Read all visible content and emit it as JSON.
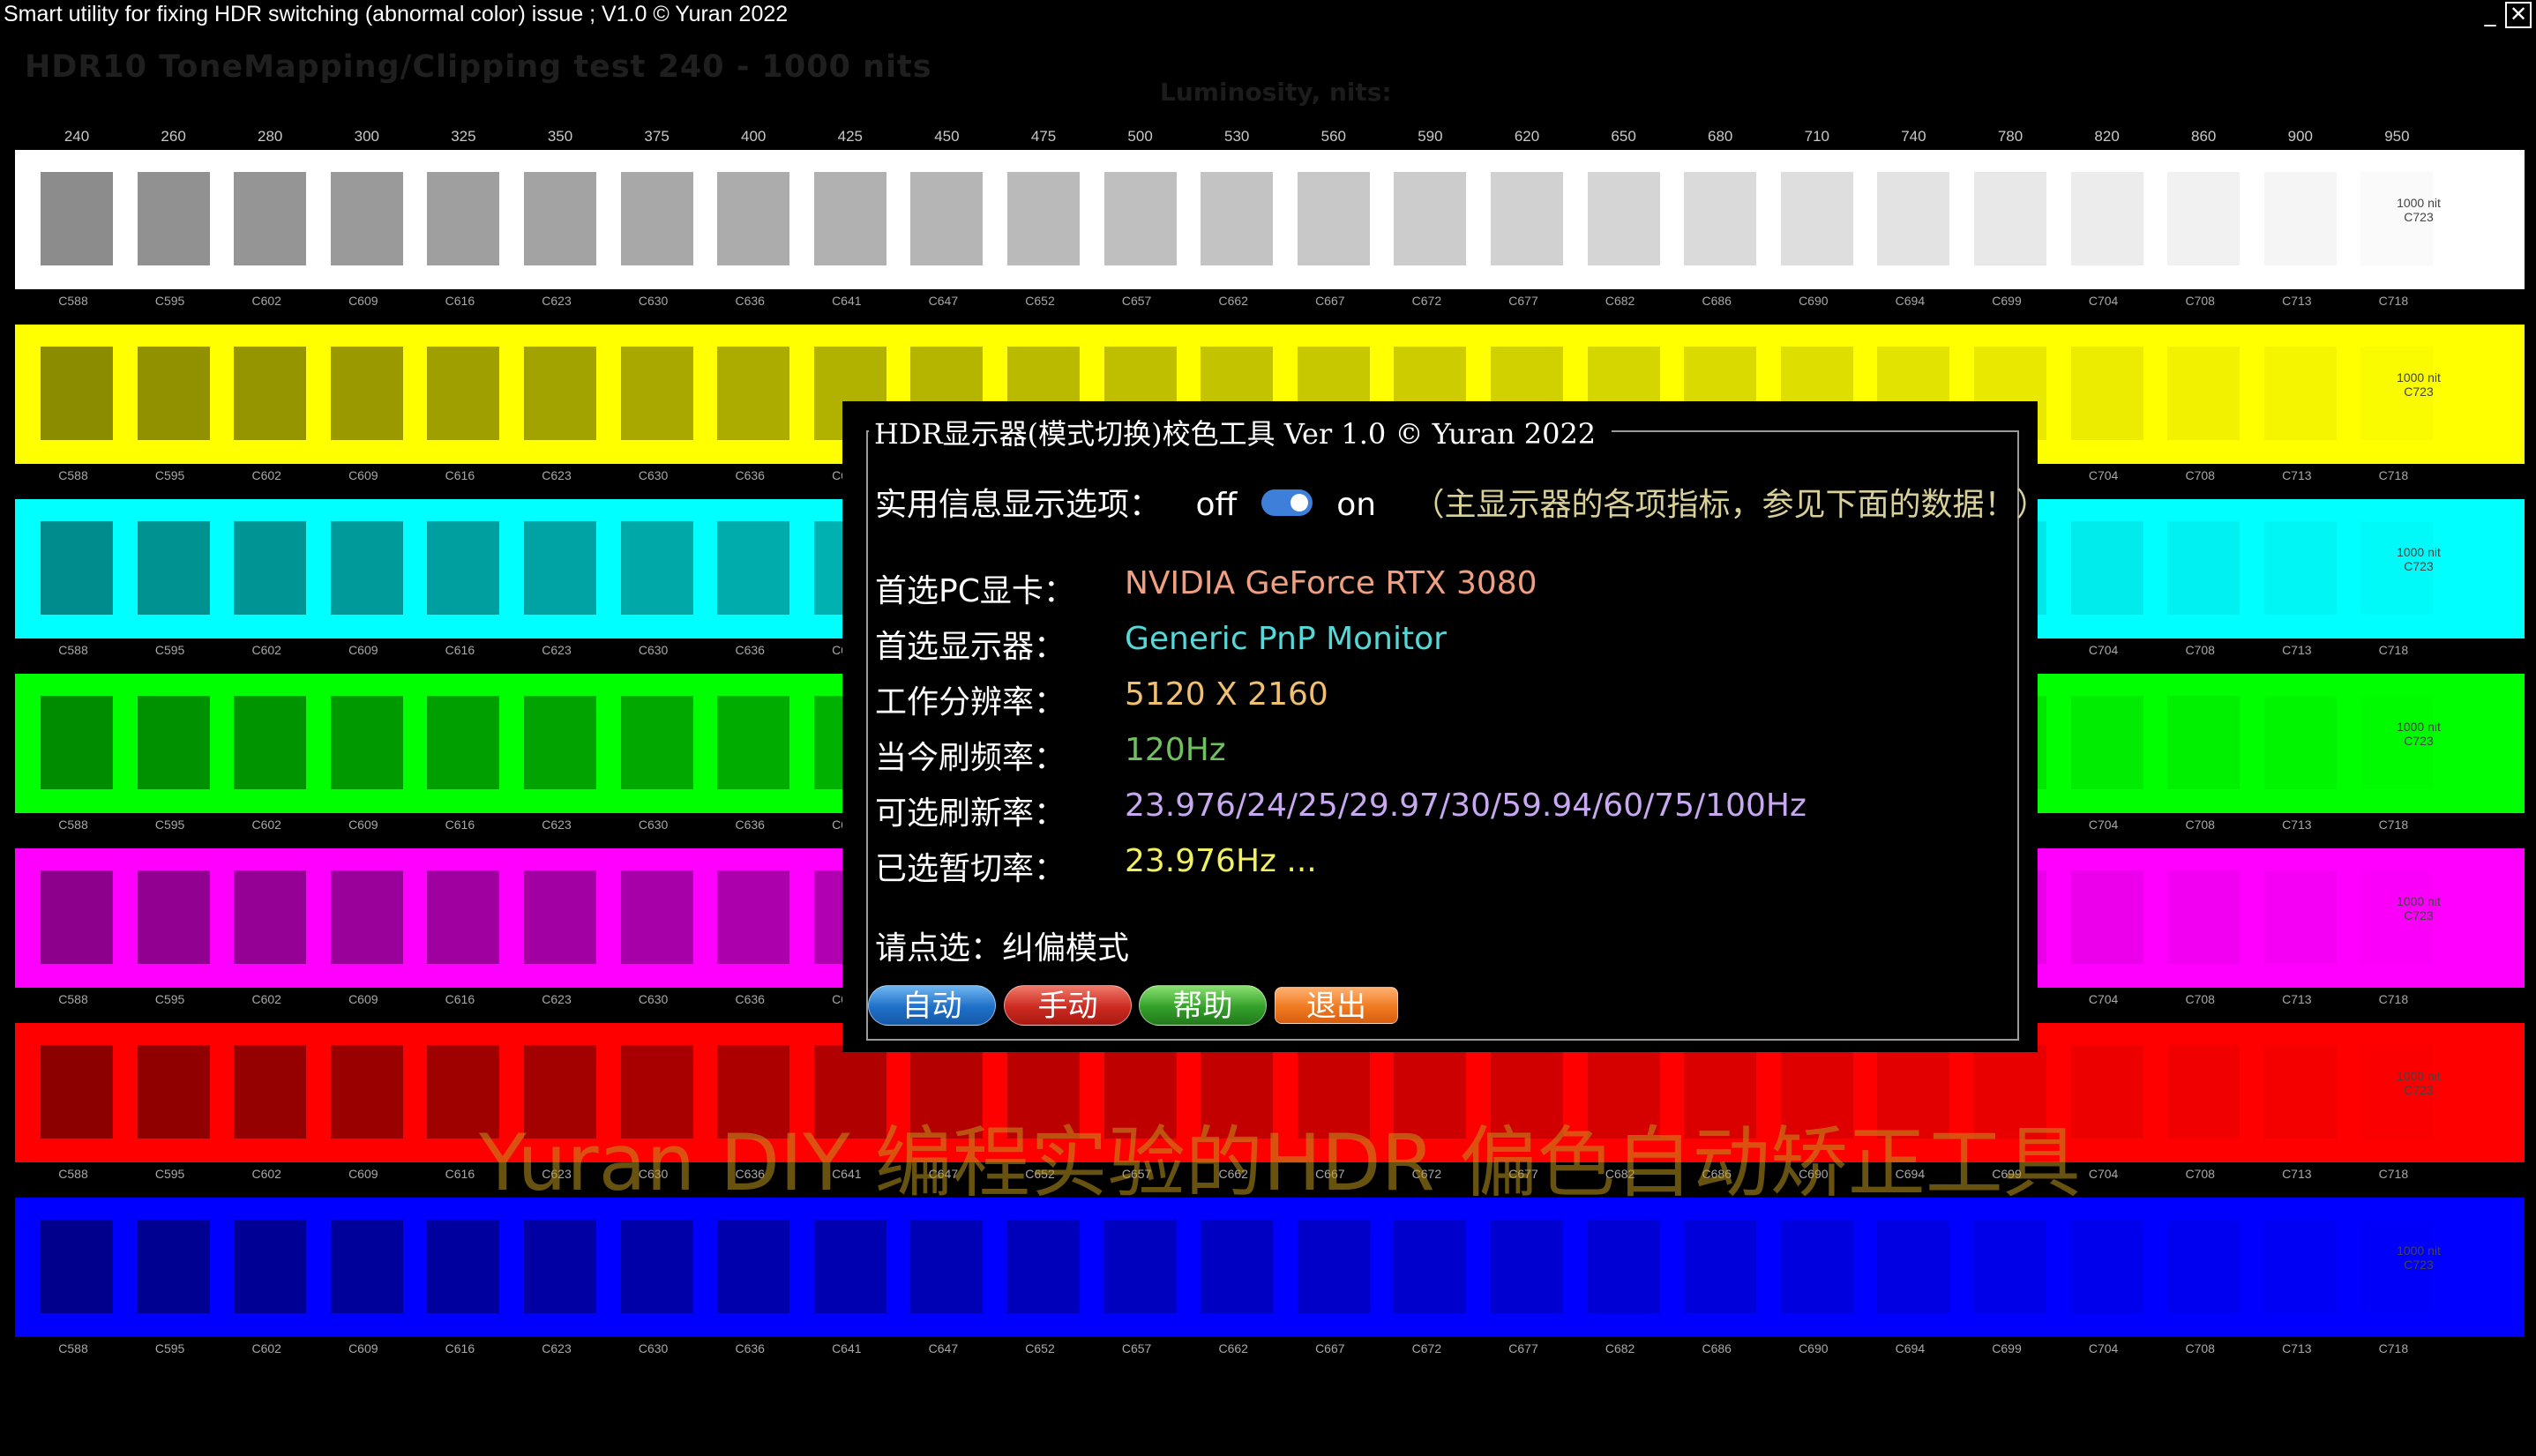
{
  "window": {
    "title": "Smart utility for fixing HDR switching (abnormal color) issue ; V1.0 © Yuran 2022",
    "minimize_icon": "_",
    "close_icon": "✕"
  },
  "test": {
    "heading": "HDR10 ToneMapping/Clipping test 240 - 1000 nits",
    "luminosity_label": "Luminosity, nits:",
    "nits": [
      "240",
      "260",
      "280",
      "300",
      "325",
      "350",
      "375",
      "400",
      "425",
      "450",
      "475",
      "500",
      "530",
      "560",
      "590",
      "620",
      "650",
      "680",
      "710",
      "740",
      "780",
      "820",
      "860",
      "900",
      "950"
    ],
    "codes": [
      "C588",
      "C595",
      "C602",
      "C609",
      "C616",
      "C623",
      "C630",
      "C636",
      "C641",
      "C647",
      "C652",
      "C657",
      "C662",
      "C667",
      "C672",
      "C677",
      "C682",
      "C686",
      "C690",
      "C694",
      "C699",
      "C704",
      "C708",
      "C713",
      "C718"
    ],
    "end_label_line1": "1000 nit",
    "end_label_line2": "C723",
    "bands": [
      {
        "name": "white",
        "color": "#ffffff"
      },
      {
        "name": "yellow",
        "color": "#ffff00"
      },
      {
        "name": "cyan",
        "color": "#00ffff"
      },
      {
        "name": "green",
        "color": "#00ff00"
      },
      {
        "name": "magenta",
        "color": "#ff00ff"
      },
      {
        "name": "red",
        "color": "#ff0000"
      },
      {
        "name": "blue",
        "color": "#0000ff"
      }
    ]
  },
  "watermark": "Yuran DIY 编程实验的HDR 偏色自动矫正工具",
  "dialog": {
    "title": "HDR显示器(模式切换)校色工具 Ver 1.0 © Yuran 2022",
    "options_label": "实用信息显示选项：",
    "toggle_off": "off",
    "toggle_on": "on",
    "toggle_state": "on",
    "options_note": "（主显示器的各项指标，参见下面的数据！）",
    "gpu_label": "首选PC显卡：",
    "gpu_value": "NVIDIA GeForce RTX 3080",
    "monitor_label": "首选显示器：",
    "monitor_value": "Generic PnP Monitor",
    "resolution_label": "工作分辨率：",
    "resolution_value": "5120 X 2160",
    "refresh_label": "当今刷频率：",
    "refresh_value": "120Hz",
    "rates_label": "可选刷新率：",
    "rates_value": "23.976/24/25/29.97/30/59.94/60/75/100Hz",
    "selected_label": "已选暂切率：",
    "selected_value": "23.976Hz ...",
    "mode_prompt": "请点选：纠偏模式",
    "buttons": {
      "auto": "自动",
      "manual": "手动",
      "help": "帮助",
      "exit": "退出"
    }
  }
}
